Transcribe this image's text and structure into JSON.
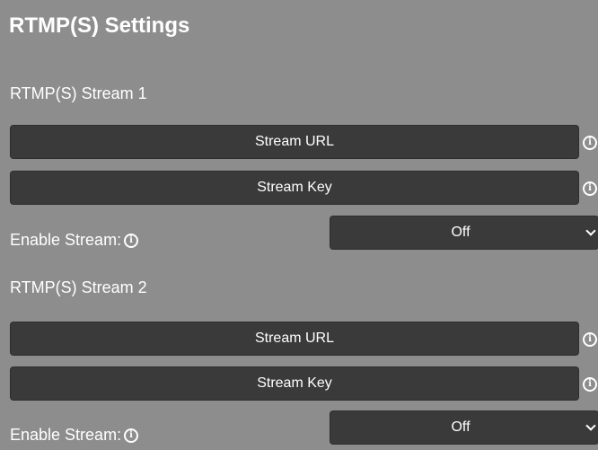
{
  "page": {
    "title": "RTMP(S) Settings"
  },
  "streams": [
    {
      "title": "RTMP(S) Stream 1",
      "url_placeholder": "Stream URL",
      "key_placeholder": "Stream Key",
      "enable_label": "Enable Stream:",
      "enable_value": "Off"
    },
    {
      "title": "RTMP(S) Stream 2",
      "url_placeholder": "Stream URL",
      "key_placeholder": "Stream Key",
      "enable_label": "Enable Stream:",
      "enable_value": "Off"
    }
  ],
  "icons": {
    "info": "info-icon",
    "dropdown": "chevron-down-icon",
    "info_glyph": "i"
  },
  "colors": {
    "page_background": "#8d8d8d",
    "field_background": "#3a3a3a",
    "text": "#ffffff"
  }
}
